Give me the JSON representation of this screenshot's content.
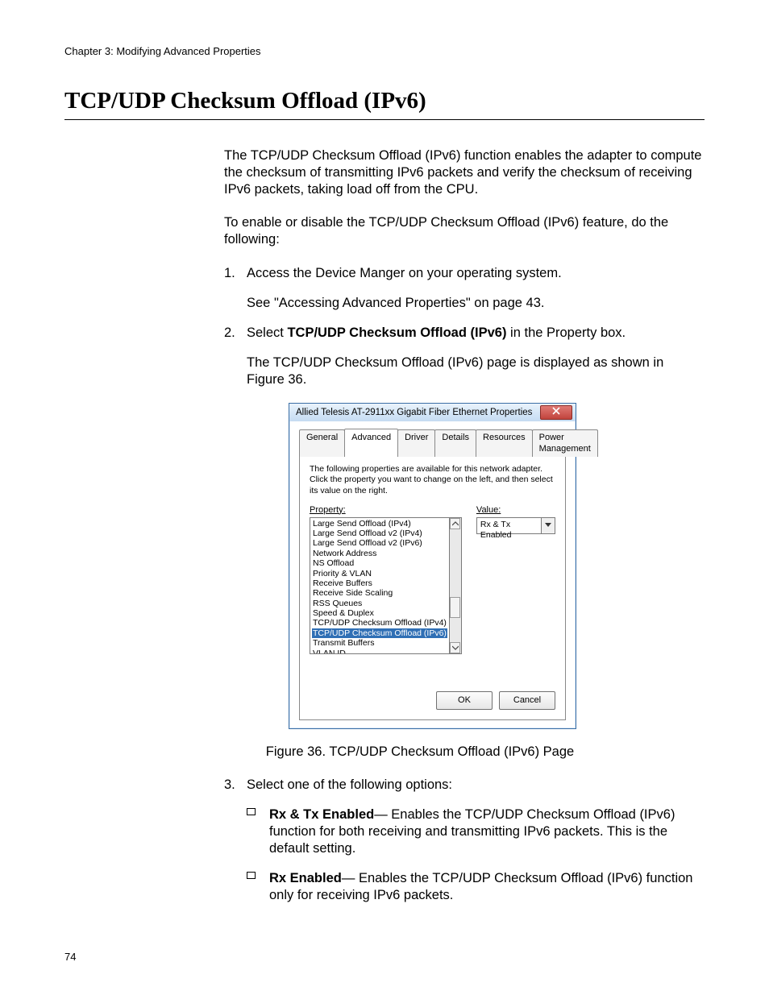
{
  "chapter_header": "Chapter 3: Modifying Advanced Properties",
  "section_title": "TCP/UDP Checksum Offload (IPv6)",
  "intro_para": "The TCP/UDP Checksum Offload (IPv6) function enables the adapter to compute the checksum of transmitting IPv6 packets and verify the checksum of receiving IPv6 packets, taking load off from the CPU.",
  "lead_in": "To enable or disable the TCP/UDP Checksum Offload (IPv6) feature, do the following:",
  "steps": {
    "s1": {
      "num": "1.",
      "text": "Access the Device Manger on your operating system.",
      "sub": "See \"Accessing Advanced Properties\" on page 43."
    },
    "s2": {
      "num": "2.",
      "text_prefix": "Select ",
      "text_bold": "TCP/UDP Checksum Offload (IPv6)",
      "text_suffix": " in the Property box.",
      "sub": "The TCP/UDP Checksum Offload (IPv6) page is displayed as shown in Figure 36."
    },
    "s3": {
      "num": "3.",
      "text": "Select one of the following options:"
    }
  },
  "bullets": {
    "b1": {
      "bold": "Rx & Tx Enabled",
      "rest": "— Enables the TCP/UDP Checksum Offload (IPv6) function for both receiving and transmitting IPv6 packets. This is the default setting."
    },
    "b2": {
      "bold": "Rx Enabled",
      "rest": "— Enables the TCP/UDP Checksum Offload (IPv6) function only for receiving IPv6 packets."
    }
  },
  "figure_caption": "Figure 36. TCP/UDP Checksum Offload (IPv6) Page",
  "page_number": "74",
  "dialog": {
    "title": "Allied Telesis AT-2911xx Gigabit Fiber Ethernet Properties",
    "tabs": [
      "General",
      "Advanced",
      "Driver",
      "Details",
      "Resources",
      "Power Management"
    ],
    "active_tab_index": 1,
    "description": "The following properties are available for this network adapter. Click the property you want to change on the left, and then select its value on the right.",
    "property_label": "Property:",
    "value_label": "Value:",
    "selected_value": "Rx & Tx Enabled",
    "ok_label": "OK",
    "cancel_label": "Cancel",
    "list_items": [
      "Large Send Offload (IPv4)",
      "Large Send Offload v2 (IPv4)",
      "Large Send Offload v2 (IPv6)",
      "Network Address",
      "NS Offload",
      "Priority & VLAN",
      "Receive Buffers",
      "Receive Side Scaling",
      "RSS Queues",
      "Speed & Duplex",
      "TCP/UDP Checksum Offload (IPv4)",
      "TCP/UDP Checksum Offload (IPv6)",
      "Transmit Buffers",
      "VLAN ID"
    ],
    "selected_list_index": 11
  }
}
